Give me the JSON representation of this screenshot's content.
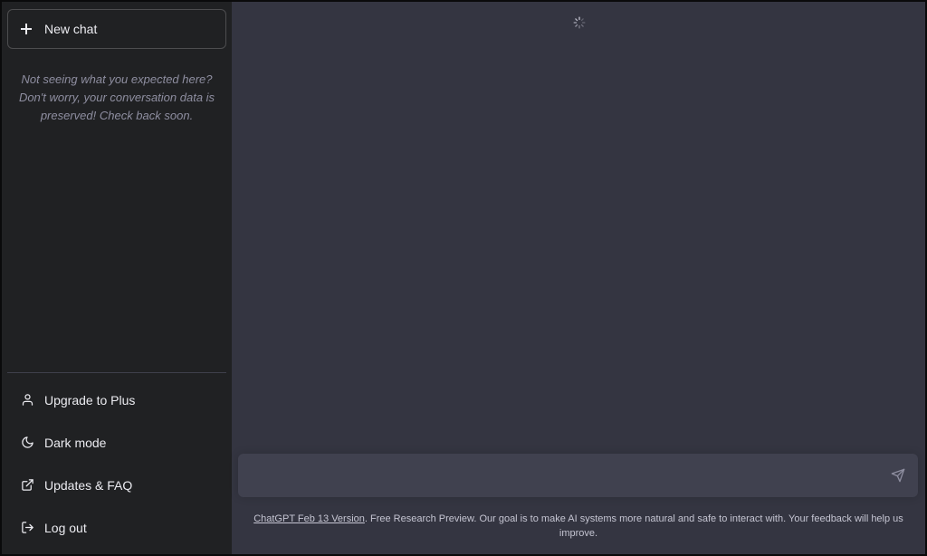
{
  "sidebar": {
    "new_chat_label": "New chat",
    "notice": "Not seeing what you expected here? Don't worry, your conversation data is preserved! Check back soon.",
    "menu": [
      {
        "label": "Upgrade to Plus",
        "icon": "user-icon"
      },
      {
        "label": "Dark mode",
        "icon": "moon-icon"
      },
      {
        "label": "Updates & FAQ",
        "icon": "external-link-icon"
      },
      {
        "label": "Log out",
        "icon": "logout-icon"
      }
    ]
  },
  "composer": {
    "value": "",
    "placeholder": ""
  },
  "footer": {
    "link_text": "ChatGPT Feb 13 Version",
    "text": ". Free Research Preview. Our goal is to make AI systems more natural and safe to interact with. Your feedback will help us improve."
  },
  "colors": {
    "sidebar_bg": "#202123",
    "main_bg": "#343541",
    "input_bg": "#40414f",
    "text": "#ececf1",
    "muted": "#8e8ea0"
  }
}
